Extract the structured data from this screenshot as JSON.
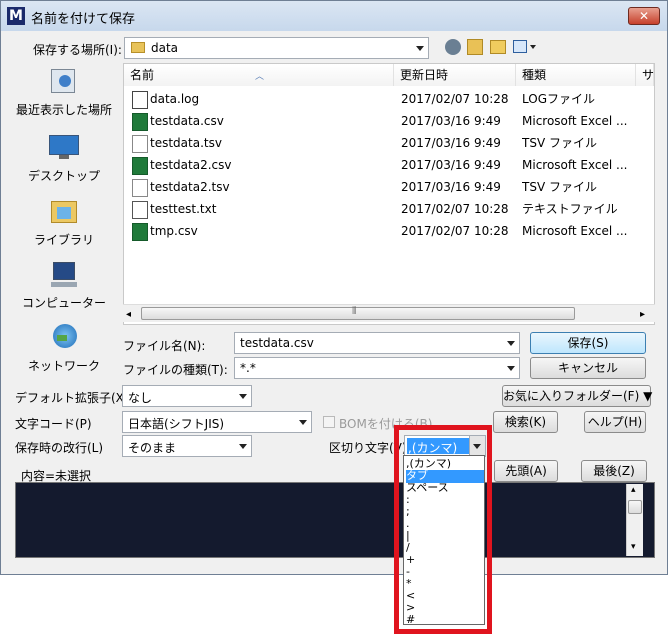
{
  "window": {
    "title": "名前を付けて保存",
    "app_icon": "M",
    "close_icon": "close-icon"
  },
  "location": {
    "label": "保存する場所(I):",
    "value": "data"
  },
  "places": [
    {
      "label": "最近表示した場所",
      "icon": "recent-places-icon"
    },
    {
      "label": "デスクトップ",
      "icon": "desktop-icon"
    },
    {
      "label": "ライブラリ",
      "icon": "library-icon"
    },
    {
      "label": "コンピューター",
      "icon": "computer-icon"
    },
    {
      "label": "ネットワーク",
      "icon": "network-icon"
    }
  ],
  "columns": [
    "名前",
    "更新日時",
    "種類",
    "サ"
  ],
  "files": [
    {
      "name": "data.log",
      "date": "2017/02/07 10:28",
      "type": "LOGファイル",
      "icon": "log"
    },
    {
      "name": "testdata.csv",
      "date": "2017/03/16 9:49",
      "type": "Microsoft Excel ...",
      "icon": "xls"
    },
    {
      "name": "testdata.tsv",
      "date": "2017/03/16 9:49",
      "type": "TSV ファイル",
      "icon": "blank"
    },
    {
      "name": "testdata2.csv",
      "date": "2017/03/16 9:49",
      "type": "Microsoft Excel ...",
      "icon": "xls"
    },
    {
      "name": "testdata2.tsv",
      "date": "2017/03/16 9:49",
      "type": "TSV ファイル",
      "icon": "blank"
    },
    {
      "name": "testtest.txt",
      "date": "2017/02/07 10:28",
      "type": "テキストファイル",
      "icon": "txt"
    },
    {
      "name": "tmp.csv",
      "date": "2017/02/07 10:28",
      "type": "Microsoft Excel ...",
      "icon": "xls"
    }
  ],
  "form": {
    "filename_label": "ファイル名(N):",
    "filename_value": "testdata.csv",
    "filetype_label": "ファイルの種類(T):",
    "filetype_value": "*.*",
    "ext_label": "デフォルト拡張子(X)",
    "ext_value": "なし",
    "charcode_label": "文字コード(P)",
    "charcode_value": "日本語(シフトJIS)",
    "bom_label": "BOMを付ける(B)",
    "newline_label": "保存時の改行(L)",
    "newline_value": "そのまま",
    "delim_label": "区切り文字(V)",
    "delim_value": ",(カンマ)",
    "content_label": "内容=未選択"
  },
  "buttons": {
    "save": "保存(S)",
    "cancel": "キャンセル",
    "favorites": "お気に入りフォルダー(F) ▼",
    "search": "検索(K)",
    "help": "ヘルプ(H)",
    "first": "先頭(A)",
    "last": "最後(Z)"
  },
  "toolbar_icons": [
    "back-icon",
    "up-folder-icon",
    "new-folder-icon",
    "view-menu-icon"
  ],
  "delimiter_options": [
    ",(カンマ)",
    "タブ",
    "スペース",
    ":",
    ";",
    ".",
    "|",
    "/",
    "+",
    "-",
    "*",
    "<",
    ">",
    "#"
  ],
  "delimiter_selected_index": 1,
  "colors": {
    "highlight": "#3399ff",
    "annotation": "#e0141e",
    "content_bg": "#141a2e"
  }
}
